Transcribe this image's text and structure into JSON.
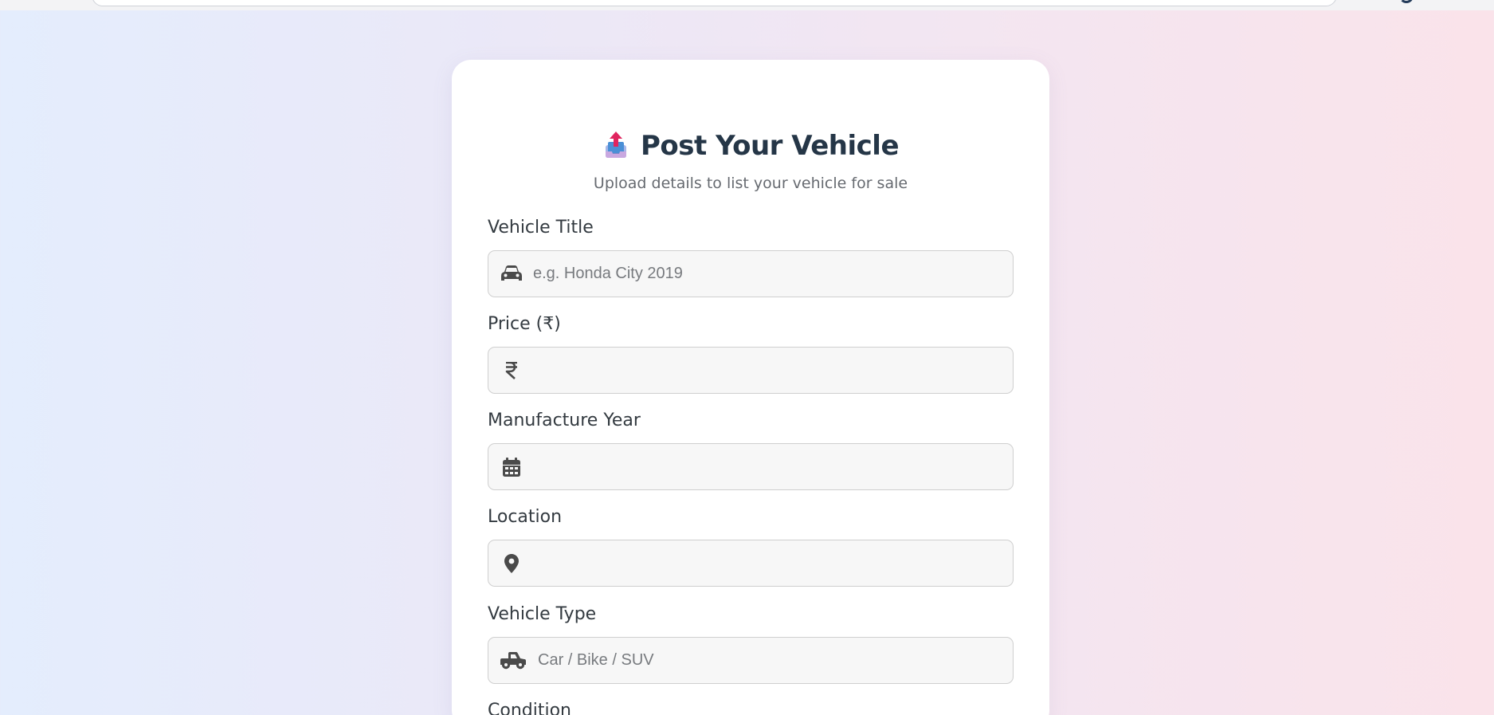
{
  "browser": {
    "colors": {
      "bar": "#f3f3f5"
    }
  },
  "page": {
    "background_colors": [
      "#e4edfd",
      "#ebe8f7",
      "#f2e6f2",
      "#fae3ea"
    ]
  },
  "form": {
    "title_icon": "outbox-tray-icon",
    "title": "Post Your Vehicle",
    "subtitle": "Upload details to list your vehicle for sale",
    "fields": [
      {
        "label": "Vehicle Title",
        "icon": "car-icon",
        "value": "",
        "placeholder": "e.g. Honda City 2019"
      },
      {
        "label": "Price (₹)",
        "icon": "rupee-icon",
        "value": "",
        "placeholder": ""
      },
      {
        "label": "Manufacture Year",
        "icon": "calendar-icon",
        "value": "",
        "placeholder": ""
      },
      {
        "label": "Location",
        "icon": "map-pin-icon",
        "value": "",
        "placeholder": ""
      },
      {
        "label": "Vehicle Type",
        "icon": "truck-pickup-icon",
        "value": "",
        "placeholder": "Car / Bike / SUV"
      },
      {
        "label": "Condition"
      }
    ],
    "colors": {
      "title": "#253647",
      "label": "#333a40",
      "icon": "#4a4a4a",
      "input_bg": "#f7f7f7",
      "input_border": "#cfcfcf"
    }
  }
}
